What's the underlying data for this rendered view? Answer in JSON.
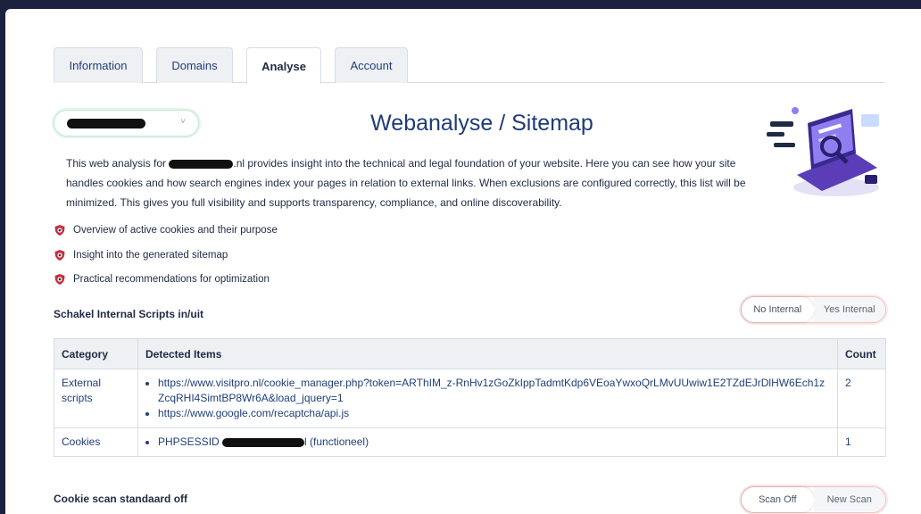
{
  "tabs": [
    {
      "label": "Information"
    },
    {
      "label": "Domains"
    },
    {
      "label": "Analyse"
    },
    {
      "label": "Account"
    }
  ],
  "domain_select": {
    "chevron": "˅"
  },
  "page_title": "Webanalyse / Sitemap",
  "intro": {
    "before": "This web analysis for ",
    "after": ".nl provides insight into the technical and legal foundation of your website. Here you can see how your site handles cookies and how search engines index your pages in relation to external links. When exclusions are configured correctly, this list will be minimized. This gives you full visibility and supports transparency, compliance, and online discoverability."
  },
  "features": [
    "Overview of active cookies and their purpose",
    "Insight into the generated sitemap",
    "Practical recommendations for optimization"
  ],
  "internal_scripts": {
    "label": "Schakel Internal Scripts in/uit",
    "option_on": "No Internal",
    "option_off": "Yes Internal"
  },
  "table": {
    "headers": [
      "Category",
      "Detected Items",
      "Count"
    ],
    "rows": [
      {
        "category": "External scripts",
        "items": [
          "https://www.visitpro.nl/cookie_manager.php?token=ARThIM_z-RnHv1zGoZkIppTadmtKdp6VEoaYwxoQrLMvUUwiw1E2TZdEJrDlHW6Ech1zZcqRHI4SimtBP8Wr6A&load_jquery=1",
          "https://www.google.com/recaptcha/api.js"
        ],
        "count": "2"
      },
      {
        "category": "Cookies",
        "item_prefix": "PHPSESSID ",
        "item_suffix": "l (functioneel)",
        "count": "1"
      }
    ]
  },
  "cookie_scan": {
    "label": "Cookie scan standaard off",
    "option_on": "Scan Off",
    "option_off": "New Scan"
  },
  "icons": {
    "feature_icon": "shield-icon"
  },
  "colors": {
    "accent": "#1e3b78",
    "toggle_border": "#f0c3c3",
    "select_border": "#bfe8cf"
  }
}
